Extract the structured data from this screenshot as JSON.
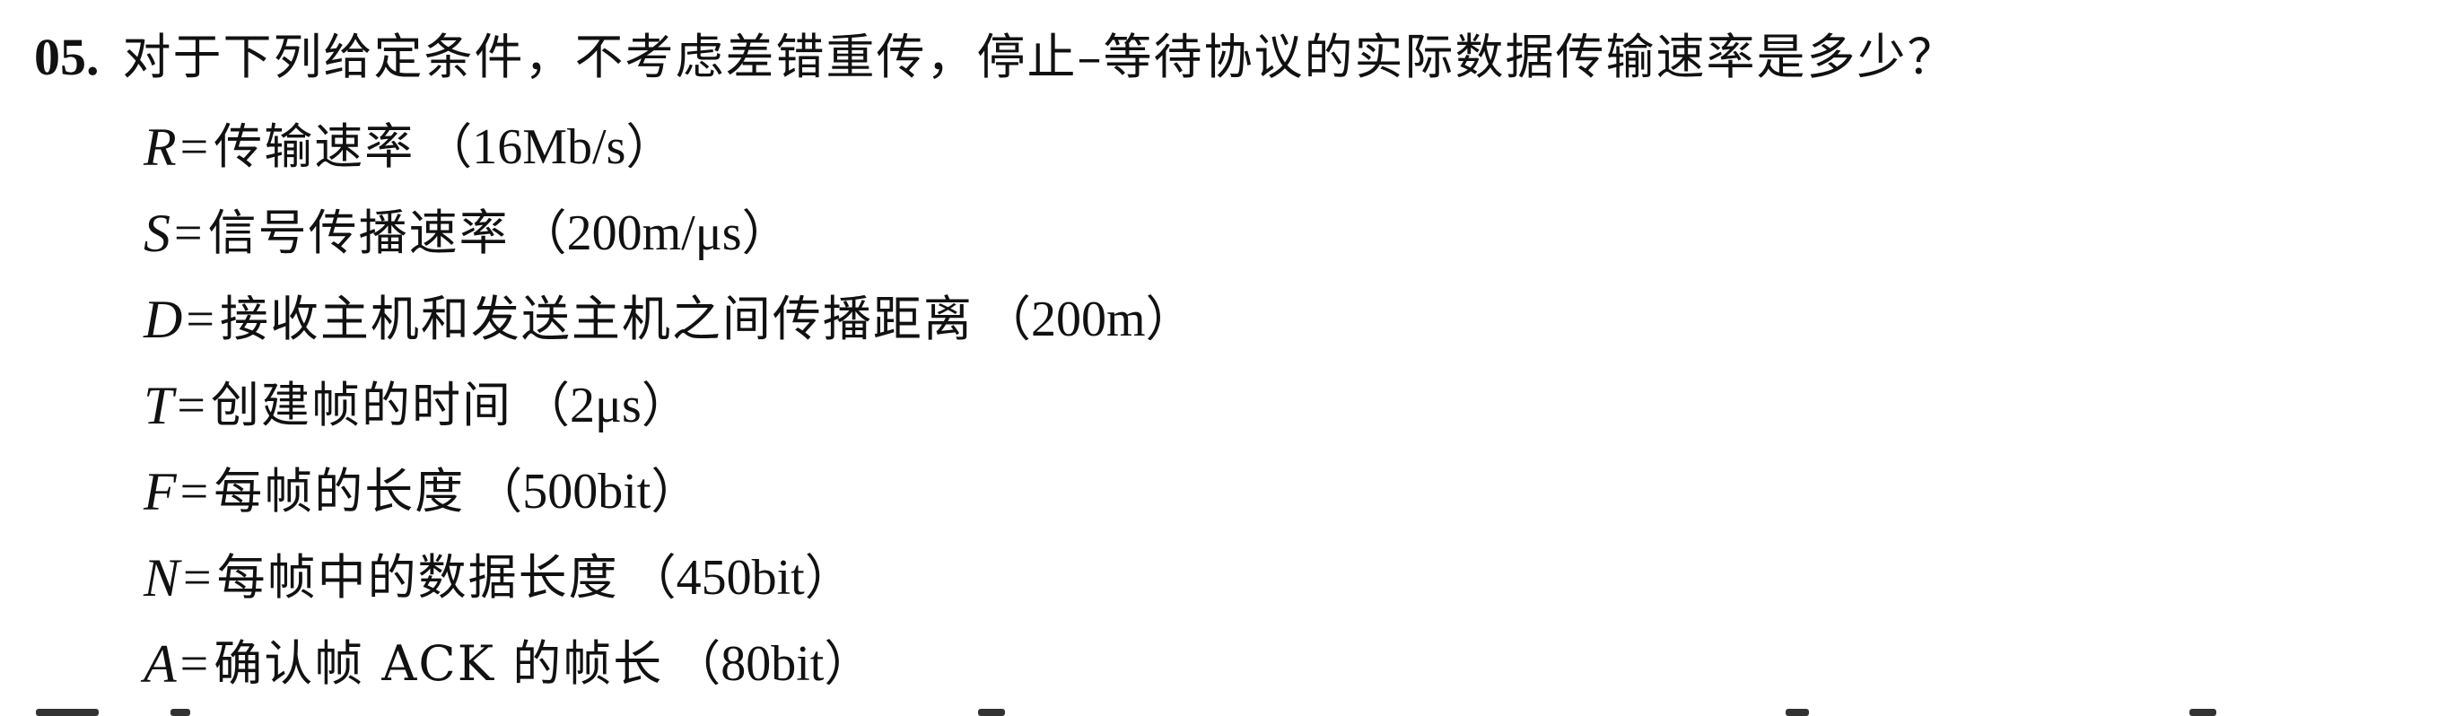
{
  "question": {
    "number": "05.",
    "text": "对于下列给定条件，不考虑差错重传，停止–等待协议的实际数据传输速率是多少？"
  },
  "variables": [
    {
      "symbol": "R",
      "eq": "=",
      "desc": "传输速率",
      "open": "（",
      "value": "16Mb/s",
      "close": "）"
    },
    {
      "symbol": "S",
      "eq": "=",
      "desc": "信号传播速率",
      "open": "（",
      "value": "200m/μs",
      "close": "）"
    },
    {
      "symbol": "D",
      "eq": "=",
      "desc": "接收主机和发送主机之间传播距离",
      "open": "（",
      "value": "200m",
      "close": "）"
    },
    {
      "symbol": "T",
      "eq": "=",
      "desc": "创建帧的时间",
      "open": "（",
      "value": "2μs",
      "close": "）"
    },
    {
      "symbol": "F",
      "eq": "=",
      "desc": "每帧的长度",
      "open": "（",
      "value": "500bit",
      "close": "）"
    },
    {
      "symbol": "N",
      "eq": "=",
      "desc": "每帧中的数据长度",
      "open": "（",
      "value": "450bit",
      "close": "）"
    },
    {
      "symbol": "A",
      "eq": "=",
      "desc": "确认帧 ACK 的帧长",
      "open": "（",
      "value": "80bit",
      "close": "）"
    }
  ],
  "colors": {
    "text": "#111111",
    "background": "#ffffff"
  }
}
